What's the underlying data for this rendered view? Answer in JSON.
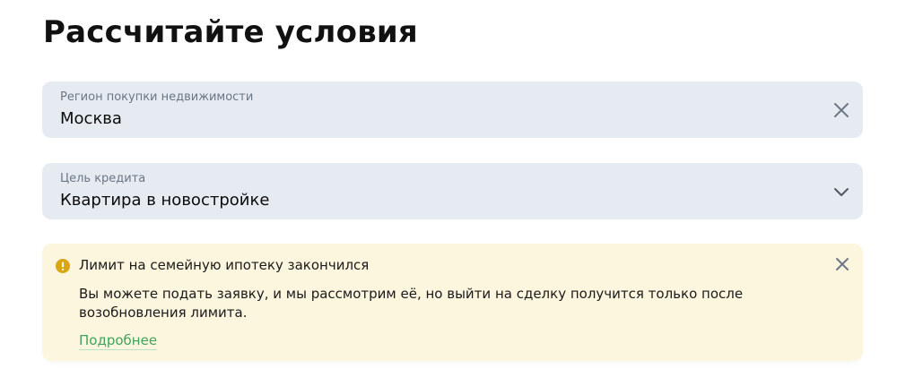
{
  "page": {
    "title": "Рассчитайте условия"
  },
  "region_field": {
    "label": "Регион покупки недвижимости",
    "value": "Москва",
    "icon": "close-icon"
  },
  "goal_field": {
    "label": "Цель кредита",
    "value": "Квартира в новостройке",
    "icon": "chevron-down-icon"
  },
  "alert": {
    "icon": "warning-icon",
    "title": "Лимит на семейную ипотеку закончился",
    "text": "Вы можете подать заявку, и мы рассмотрим её, но выйти на сделку получится только после возобновления лимита.",
    "link": "Подробнее",
    "close_icon": "close-icon"
  },
  "colors": {
    "field_bg": "#e6ebf2",
    "alert_bg": "#fdf6de",
    "warning": "#d9a514",
    "link": "#3fa35e"
  }
}
